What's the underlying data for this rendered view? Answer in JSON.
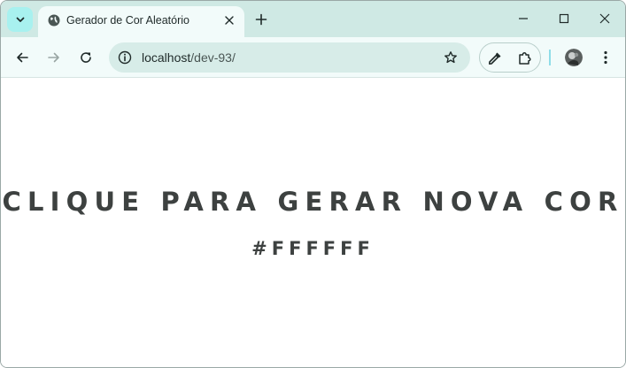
{
  "browser": {
    "tab": {
      "title": "Gerador de Cor Aleatório",
      "favicon": "globe-icon"
    },
    "address": {
      "host": "localhost",
      "path": "/dev-93/"
    },
    "colors": {
      "tabstrip": "#cfe9e4",
      "toolbar": "#f2fbfa",
      "omnibox": "#d7ece8",
      "accent": "#a8f1ef"
    }
  },
  "page": {
    "headline": "CLIQUE PARA GERAR NOVA COR",
    "color_hex": "#FFFFFF",
    "background": "#ffffff"
  }
}
